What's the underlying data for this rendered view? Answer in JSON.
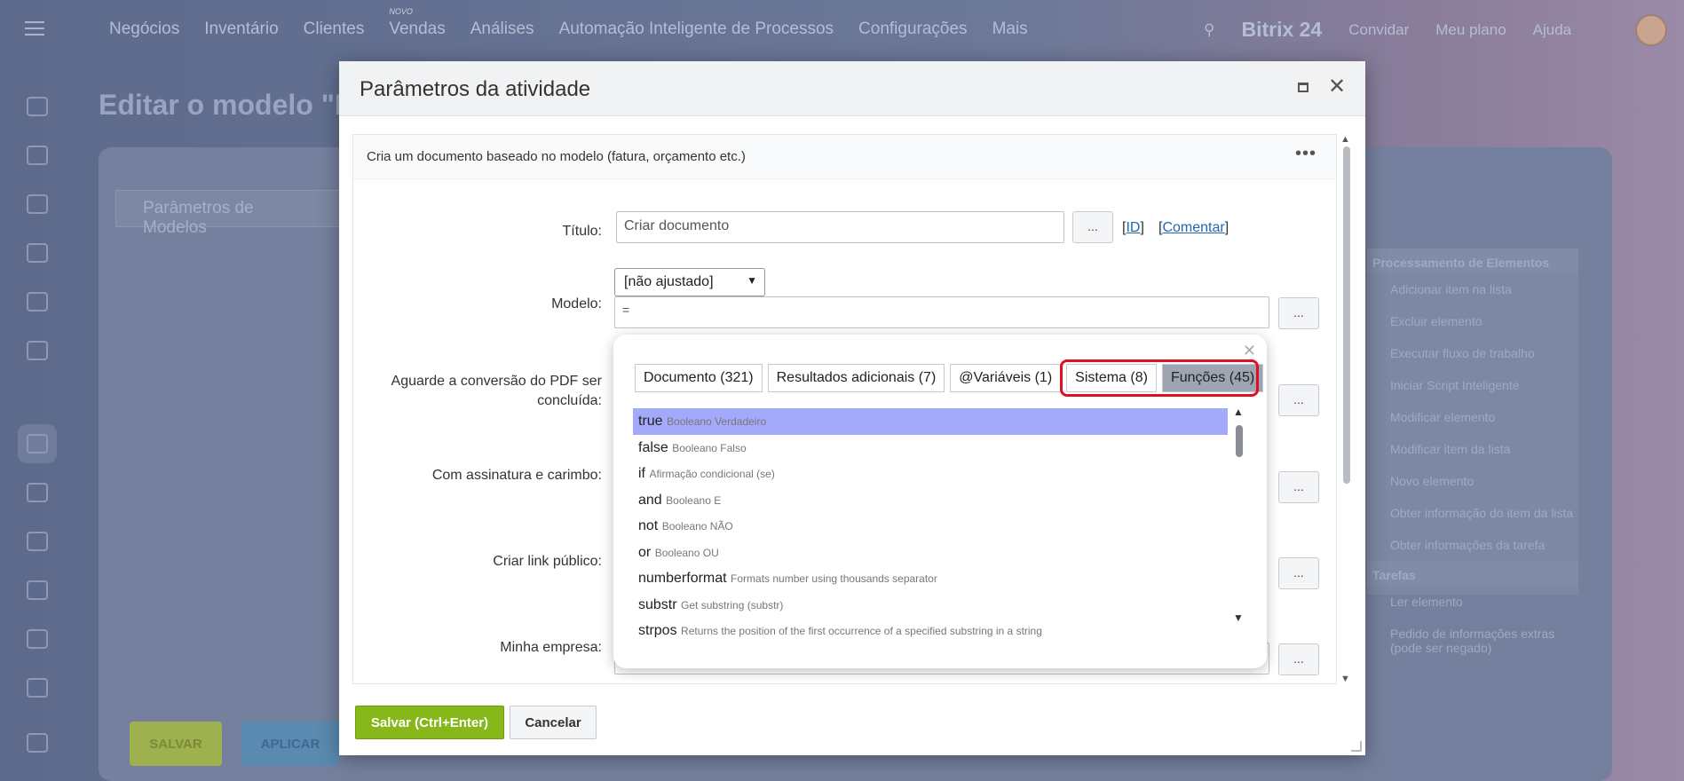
{
  "topbar": {
    "nav": [
      "Negócios",
      "Inventário",
      "Clientes",
      "Vendas",
      "Análises",
      "Automação Inteligente de Processos",
      "Configurações",
      "Mais"
    ],
    "novo_badge": "NOVO",
    "logo": "Bitrix 24",
    "invite": "Convidar",
    "plan": "Meu plano",
    "help": "Ajuda"
  },
  "background": {
    "page_title": "Editar o modelo \"N",
    "tab": "Parâmetros de Modelos",
    "panel_header1": "Processamento de Elementos",
    "panel_items": [
      "Adicionar item na lista",
      "Excluir elemento",
      "Executar fluxo de trabalho",
      "Iniciar Script Inteligente",
      "Modificar elemento",
      "Modificar item da lista",
      "Novo elemento",
      "Obter informação do item da lista",
      "Obter informações da tarefa"
    ],
    "panel_header2": "Tarefas",
    "panel_items2": [
      "Ler elemento",
      "Pedido de informações extras (pode ser negado)"
    ],
    "save_btn": "SALVAR",
    "apply_btn": "APLICAR"
  },
  "dialog": {
    "title": "Parâmetros da atividade",
    "description": "Cria um documento baseado no modelo (fatura, orçamento etc.)",
    "fields": {
      "titulo_label": "Título:",
      "titulo_value": "Criar documento",
      "id_link": "ID",
      "comment_link": "Comentar",
      "modelo_label": "Modelo:",
      "modelo_select": "[não ajustado]",
      "modelo_value": "=",
      "aguarde_label": "Aguarde a conversão do PDF ser concluída:",
      "assinatura_label": "Com assinatura e carimbo:",
      "link_label": "Criar link público:",
      "empresa_label": "Minha empresa:"
    },
    "btn_more": "...",
    "save": "Salvar (Ctrl+Enter)",
    "cancel": "Cancelar"
  },
  "popup": {
    "tabs": [
      "Documento (321)",
      "Resultados adicionais (7)",
      "@Variáveis (1)",
      "Sistema (8)",
      "Funções (45)"
    ],
    "selected_tab": "Funções (45)",
    "items": [
      {
        "name": "true",
        "desc": "Booleano Verdadeiro"
      },
      {
        "name": "false",
        "desc": "Booleano Falso"
      },
      {
        "name": "if",
        "desc": "Afirmação condicional (se)"
      },
      {
        "name": "and",
        "desc": "Booleano E"
      },
      {
        "name": "not",
        "desc": "Booleano NÃO"
      },
      {
        "name": "or",
        "desc": "Booleano OU"
      },
      {
        "name": "numberformat",
        "desc": "Formats number using thousands separator"
      },
      {
        "name": "substr",
        "desc": "Get substring (substr)"
      },
      {
        "name": "strpos",
        "desc": "Returns the position of the first occurrence of a specified substring in a string"
      }
    ]
  }
}
